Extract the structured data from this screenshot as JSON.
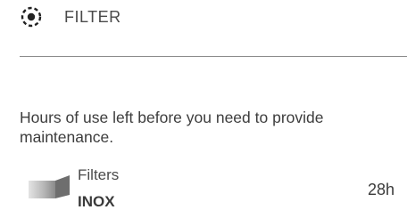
{
  "header": {
    "icon": "filter-icon",
    "title": "FILTER"
  },
  "description": "Hours of use left before you need to provide maintenance.",
  "filters": [
    {
      "label": "Filters",
      "name": "INOX",
      "hours_left": "28h",
      "icon": "filter-thumbnail-icon"
    }
  ]
}
